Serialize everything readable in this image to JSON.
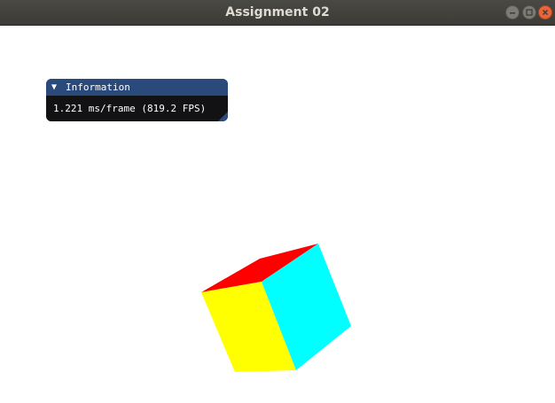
{
  "window": {
    "title": "Assignment 02"
  },
  "titlebar_buttons": [
    "minimize-icon",
    "maximize-icon",
    "close-icon"
  ],
  "info_panel": {
    "title": "Information",
    "collapse_arrow": "▼",
    "frame_stats": "1.221 ms/frame (819.2 FPS)"
  },
  "cube": {
    "face_colors": {
      "top": "#ff0000",
      "front": "#ffff00",
      "side": "#00ffff"
    }
  },
  "colors": {
    "titlebar_bg": "#3c3b37",
    "title_text": "#dfdbd2",
    "close_button": "#e9643a",
    "panel_header": "#294a7a",
    "panel_body": "#121214",
    "viewport_bg": "#ffffff"
  }
}
